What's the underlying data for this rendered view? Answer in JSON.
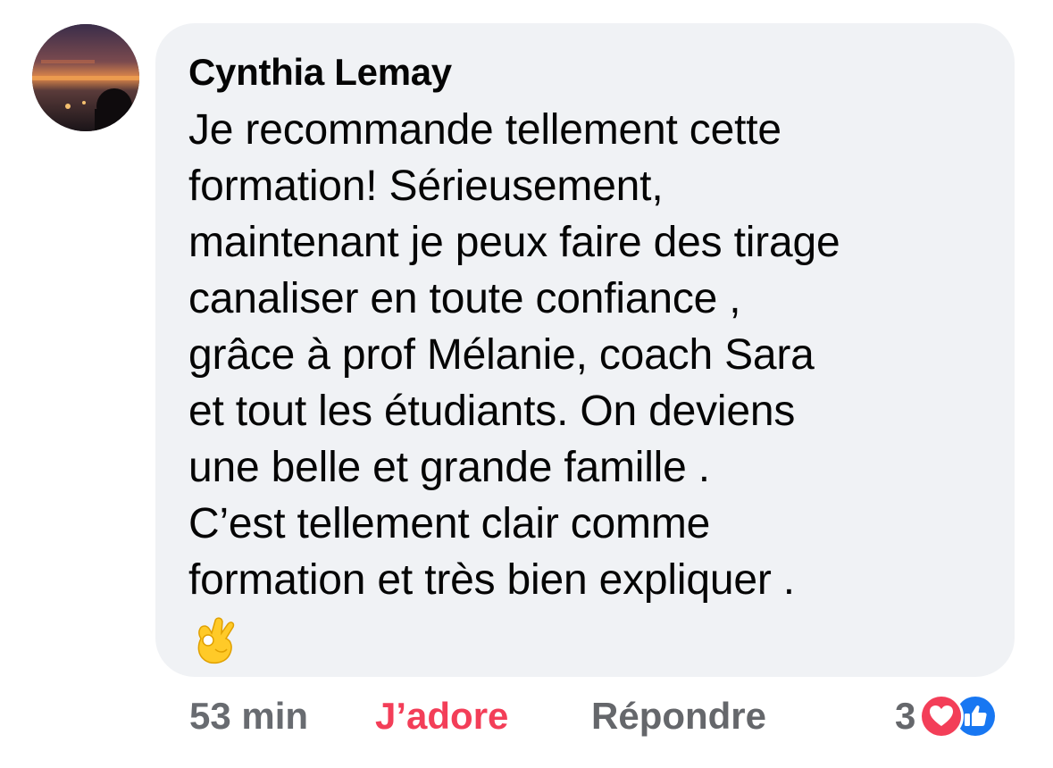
{
  "comment": {
    "author": "Cynthia Lemay",
    "text": "Je recommande tellement cette\nformation! Sérieusement,\nmaintenant je peux faire des tirage\ncanaliser en toute confiance ,\ngrâce à prof Mélanie, coach Sara\net tout les étudiants. On deviens\nune belle et grande famille .\nC’est tellement clair comme\nformation et très bien expliquer .",
    "emoji": "👌",
    "emoji_name": "ok-hand-icon"
  },
  "actions": {
    "time": "53 min",
    "reaction_label": "J’adore",
    "reply_label": "Répondre",
    "reaction_count": "3"
  },
  "colors": {
    "bubble": "#f0f2f5",
    "text": "#050505",
    "secondary": "#65676b",
    "love": "#f33e58",
    "like": "#1877f2"
  },
  "icons": [
    "avatar",
    "love-reaction-icon",
    "like-reaction-icon"
  ]
}
